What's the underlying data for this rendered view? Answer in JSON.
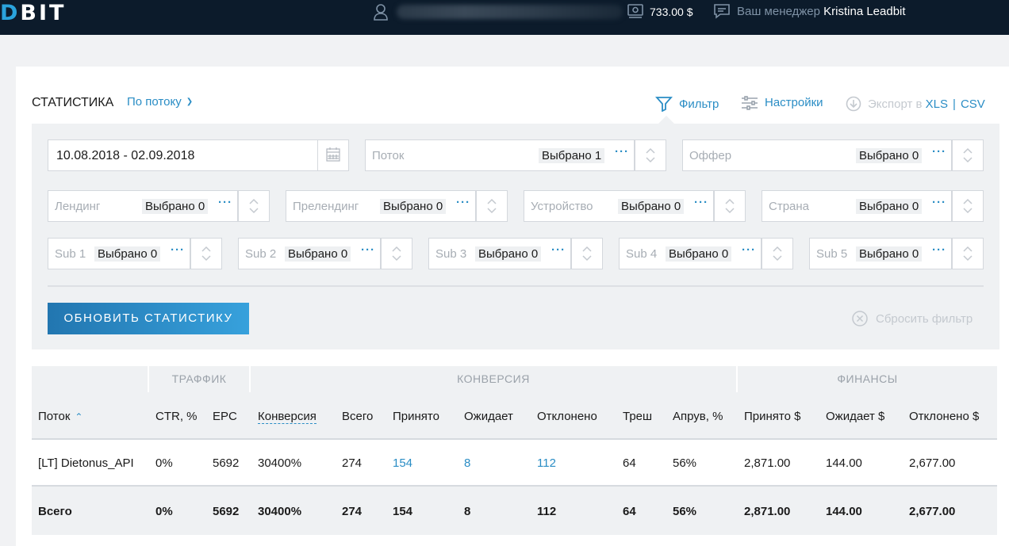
{
  "brand": {
    "logo_prefix": "D",
    "logo_rest": "BIT"
  },
  "topbar": {
    "balance": "733.00 $",
    "manager_label": "Ваш менеджер",
    "manager_name": "Kristina Leadbit"
  },
  "header": {
    "title": "СТАТИСТИКА",
    "grouping": "По потоку",
    "filter": "Фильтр",
    "settings": "Настройки",
    "export_label": "Экспорт в",
    "export_xls": "XLS",
    "export_sep": "|",
    "export_csv": "CSV"
  },
  "filters": {
    "date_range": "10.08.2018 - 02.09.2018",
    "fields": [
      {
        "placeholder": "Поток",
        "selected": "Выбрано 1"
      },
      {
        "placeholder": "Оффер",
        "selected": "Выбрано 0"
      },
      {
        "placeholder": "Лендинг",
        "selected": "Выбрано 0"
      },
      {
        "placeholder": "Прелендинг",
        "selected": "Выбрано 0"
      },
      {
        "placeholder": "Устройство",
        "selected": "Выбрано 0"
      },
      {
        "placeholder": "Страна",
        "selected": "Выбрано 0"
      },
      {
        "placeholder": "Sub 1",
        "selected": "Выбрано 0"
      },
      {
        "placeholder": "Sub 2",
        "selected": "Выбрано 0"
      },
      {
        "placeholder": "Sub 3",
        "selected": "Выбрано 0"
      },
      {
        "placeholder": "Sub 4",
        "selected": "Выбрано 0"
      },
      {
        "placeholder": "Sub 5",
        "selected": "Выбрано 0"
      }
    ],
    "more": "···",
    "update_button": "ОБНОВИТЬ СТАТИСТИКУ",
    "reset": "Сбросить фильтр"
  },
  "table": {
    "groups": [
      "ТРАФФИК",
      "КОНВЕРСИЯ",
      "ФИНАНСЫ"
    ],
    "columns": [
      "Поток",
      "CTR, %",
      "EPC",
      "Конверсия",
      "Всего",
      "Принято",
      "Ожидает",
      "Отклонено",
      "Треш",
      "Апрув, %",
      "Принято $",
      "Ожидает $",
      "Отклонено $"
    ],
    "sort_arrow": "⌃",
    "rows": [
      [
        "[LT] Dietonus_API",
        "0%",
        "5692",
        "30400%",
        "274",
        "154",
        "8",
        "112",
        "64",
        "56%",
        "2,871.00",
        "144.00",
        "2,677.00"
      ]
    ],
    "total": [
      "Всего",
      "0%",
      "5692",
      "30400%",
      "274",
      "154",
      "8",
      "112",
      "64",
      "56%",
      "2,871.00",
      "144.00",
      "2,677.00"
    ]
  }
}
